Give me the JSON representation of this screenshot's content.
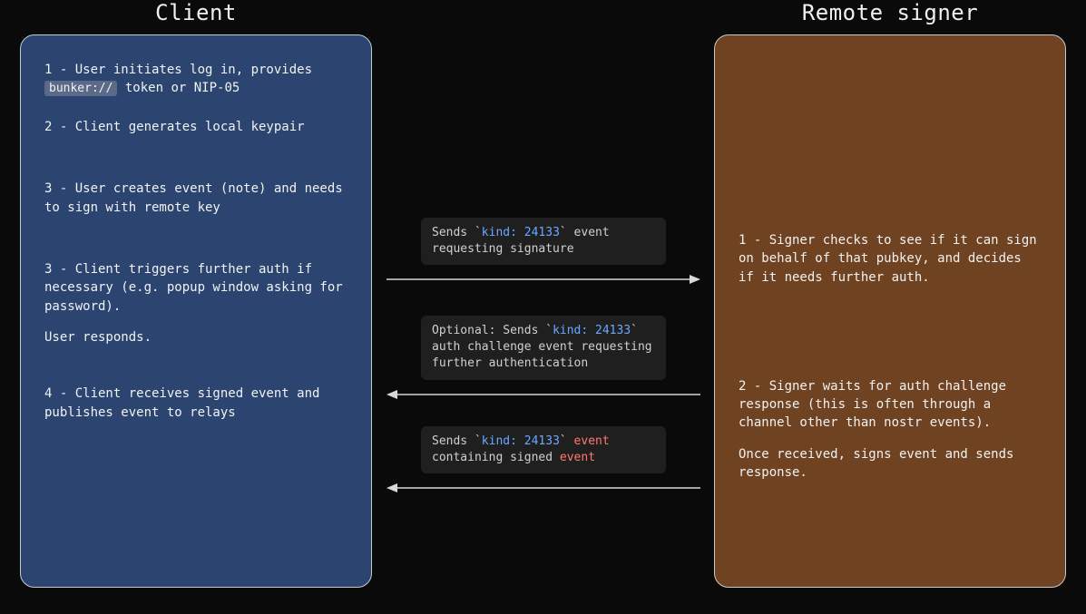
{
  "titles": {
    "client": "Client",
    "signer": "Remote signer"
  },
  "client": {
    "step1_a": "1 - User initiates log in, provides ",
    "step1_code": "bunker://",
    "step1_b": " token or NIP-05",
    "step2": "2 - Client generates local keypair",
    "step3a": "3 - User creates event (note) and needs to sign with remote key",
    "step3b_a": "3 - Client triggers further auth if necessary (e.g. popup window asking for password).",
    "step3b_b": "User responds.",
    "step4": "4 - Client receives signed event and publishes event to relays"
  },
  "signer": {
    "step1": "1 - Signer checks to see if it can sign on behalf of that pubkey, and decides if it needs further auth.",
    "step2_a": "2 - Signer waits for auth challenge response (this is often through a channel other than nostr events).",
    "step2_b": "Once received, signs event and sends response."
  },
  "messages": {
    "m1_a": "Sends `",
    "m1_kind": "kind: 24133",
    "m1_b": "` event requesting signature",
    "m2_a": "Optional: Sends `",
    "m2_kind": "kind: 24133",
    "m2_b": "` auth challenge event requesting further authentication",
    "m3_a": "Sends `",
    "m3_kind": "kind: 24133",
    "m3_b": "` ",
    "m3_event1": "event",
    "m3_c": " containing signed ",
    "m3_event2": "event"
  }
}
